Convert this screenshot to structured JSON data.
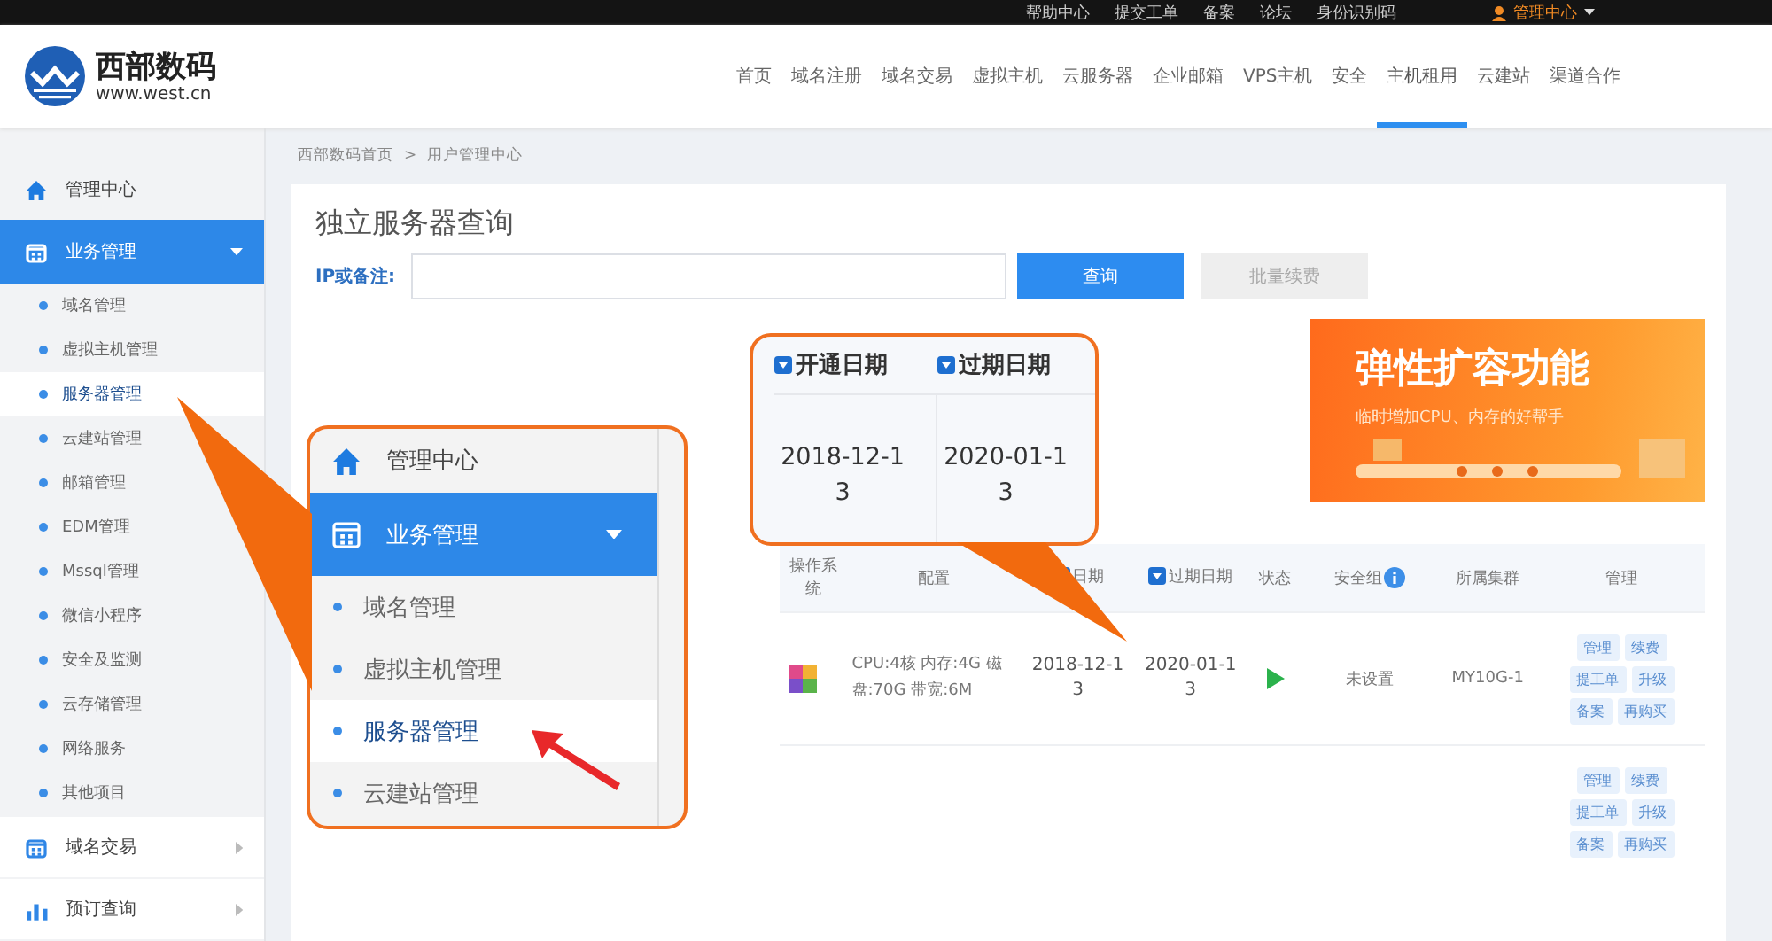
{
  "top_bar": {
    "links": [
      "帮助中心",
      "提交工单",
      "备案",
      "论坛",
      "身份识别码"
    ],
    "user_menu": "管理中心"
  },
  "header": {
    "brand": "西部数码",
    "domain": "www.west.cn",
    "nav": [
      {
        "label": "首页",
        "selected": false
      },
      {
        "label": "域名注册",
        "selected": false
      },
      {
        "label": "域名交易",
        "selected": false
      },
      {
        "label": "虚拟主机",
        "selected": false
      },
      {
        "label": "云服务器",
        "selected": false
      },
      {
        "label": "企业邮箱",
        "selected": false
      },
      {
        "label": "VPS主机",
        "selected": false
      },
      {
        "label": "安全",
        "selected": false
      },
      {
        "label": "主机租用",
        "selected": true
      },
      {
        "label": "云建站",
        "selected": false
      },
      {
        "label": "渠道合作",
        "selected": false
      }
    ]
  },
  "sidebar": {
    "items": [
      {
        "label": "管理中心",
        "kind": "link",
        "selected": false
      },
      {
        "label": "业务管理",
        "kind": "group",
        "selected": true,
        "expanded": true,
        "children": [
          {
            "label": "域名管理",
            "selected": false
          },
          {
            "label": "虚拟主机管理",
            "selected": false
          },
          {
            "label": "服务器管理",
            "selected": true
          },
          {
            "label": "云建站管理",
            "selected": false
          },
          {
            "label": "邮箱管理",
            "selected": false
          },
          {
            "label": "EDM管理",
            "selected": false
          },
          {
            "label": "Mssql管理",
            "selected": false
          },
          {
            "label": "微信小程序",
            "selected": false
          },
          {
            "label": "安全及监测",
            "selected": false
          },
          {
            "label": "云存储管理",
            "selected": false
          },
          {
            "label": "网络服务",
            "selected": false
          },
          {
            "label": "其他项目",
            "selected": false
          }
        ]
      },
      {
        "label": "域名交易",
        "kind": "group",
        "selected": false,
        "expanded": false
      },
      {
        "label": "预订查询",
        "kind": "group",
        "selected": false,
        "expanded": false
      }
    ]
  },
  "breadcrumb": {
    "items": [
      "西部数码首页",
      "用户管理中心"
    ],
    "separator": ">"
  },
  "page": {
    "title": "独立服务器查询",
    "search_label": "IP或备注:",
    "buttons": [
      {
        "label": "查询",
        "kind": "primary"
      },
      {
        "label": "批量续费",
        "kind": "secondary"
      }
    ]
  },
  "banner": {
    "title": "弹性扩容功能",
    "subtitle": "临时增加CPU、内存的好帮手"
  },
  "table": {
    "columns": [
      "操作系统",
      "配置",
      "日期",
      "过期日期",
      "状态",
      "安全组",
      "所属集群",
      "管理"
    ],
    "rows": [
      {
        "config": "CPU:4核 内存:4G 磁盘:70G 带宽:6M",
        "opened": "2018-12-13",
        "expires": "2020-01-13",
        "running": true,
        "security": "未设置",
        "cluster": "MY10G-1",
        "actions": [
          "管理",
          "续费",
          "提工单",
          "升级",
          "备案",
          "再购买"
        ]
      },
      {
        "actions": [
          "管理",
          "续费",
          "提工单",
          "升级",
          "备案",
          "再购买"
        ]
      }
    ]
  },
  "callouts": [
    {
      "kind": "menu",
      "items": [
        {
          "label": "管理中心",
          "kind": "link",
          "selected": false
        },
        {
          "label": "业务管理",
          "kind": "group",
          "selected": true,
          "expanded": true,
          "children": [
            {
              "label": "域名管理",
              "selected": false
            },
            {
              "label": "虚拟主机管理",
              "selected": false
            },
            {
              "label": "服务器管理",
              "selected": true
            },
            {
              "label": "云建站管理",
              "selected": false
            }
          ]
        }
      ]
    },
    {
      "kind": "dates",
      "columns": [
        "开通日期",
        "过期日期"
      ],
      "values": [
        "2018-12-13",
        "2020-01-13"
      ]
    }
  ]
}
